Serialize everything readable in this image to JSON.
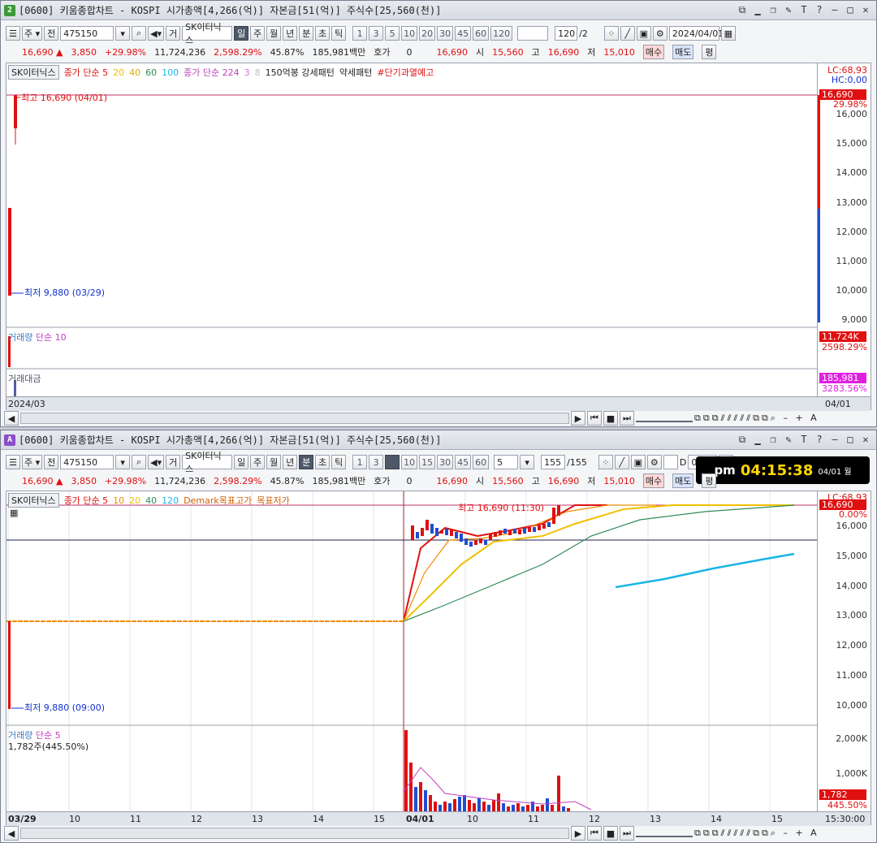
{
  "top": {
    "badge": "2",
    "title": "[0600] 키움종합차트 - KOSPI 시가총액[4,266(억)] 자본금[51(억)] 주식수[25,560(천)]",
    "toolbar": {
      "code": "475150",
      "name": "SK이터닉스",
      "periods": [
        "일",
        "주",
        "월",
        "년",
        "분",
        "초",
        "틱"
      ],
      "period_selected": "일",
      "nums": [
        "1",
        "3",
        "5",
        "10",
        "20",
        "30",
        "45",
        "60",
        "120"
      ],
      "count": "120",
      "count_suffix": "/2",
      "date": "2024/04/01"
    },
    "quote": {
      "price": "16,690",
      "change": "3,850",
      "rate": "+29.98%",
      "volume": "11,724,236",
      "vol_rate": "2,598.29%",
      "turnover": "45.87%",
      "amount": "185,981백만",
      "hoga_label": "호가",
      "hoga": "0",
      "last": "16,690",
      "open_l": "시",
      "open": "15,560",
      "high_l": "고",
      "high": "16,690",
      "low_l": "저",
      "low": "15,010",
      "buy": "매수",
      "sell": "매도",
      "avg": "평"
    },
    "legend": {
      "name": "SK이터닉스",
      "ma_label": "종가 단순 5",
      "ma2": "20",
      "ma3": "40",
      "ma4": "60",
      "ma5": "100",
      "ma_label2": "종가 단순 224",
      "m3": "3",
      "m8": "8",
      "pattern1": "150억봉 강세패턴",
      "pattern2": "약세패턴",
      "warn": "#단기과열예고"
    },
    "lc": "LC:68,93",
    "hc": "HC:0,00",
    "hi_label": "최고 16,690 (04/01)",
    "lo_label": "최저 9,880 (03/29)",
    "price_tag": "16,690",
    "pct_tag": "29.98%",
    "y_ticks": [
      "16,000",
      "15,000",
      "14,000",
      "13,000",
      "12,000",
      "11,000",
      "10,000",
      "9,000"
    ],
    "vol_legend": "거래량",
    "vol_ma": "단순 10",
    "vol_tag": "11,724K",
    "vol_pct": "2598.29%",
    "amt_legend": "거래대금",
    "amt_tag": "185,981",
    "amt_pct": "3283.56%",
    "x_left": "2024/03",
    "x_right": "04/01"
  },
  "bottom": {
    "badge": "A",
    "title": "[0600] 키움종합차트 - KOSPI 시가총액[4,266(억)] 자본금[51(억)] 주식수[25,560(천)]",
    "toolbar": {
      "code": "475150",
      "name": "SK이터닉스",
      "periods": [
        "일",
        "주",
        "월",
        "년",
        "분",
        "초",
        "틱"
      ],
      "period_selected": "분",
      "nums": [
        "1",
        "3",
        "5",
        "10",
        "15",
        "30",
        "45",
        "60"
      ],
      "num_selected": "5",
      "interval": "5",
      "count": "155",
      "count_suffix": "/155",
      "check_label": "D",
      "date": "04/01"
    },
    "clock": {
      "ampm": "pm",
      "time": "04:15:38",
      "date": "04/01 월"
    },
    "quote": {
      "price": "16,690",
      "change": "3,850",
      "rate": "+29.98%",
      "volume": "11,724,236",
      "vol_rate": "2,598.29%",
      "turnover": "45.87%",
      "amount": "185,981백만",
      "hoga_label": "호가",
      "hoga": "0",
      "last": "16,690",
      "open_l": "시",
      "open": "15,560",
      "high_l": "고",
      "high": "16,690",
      "low_l": "저",
      "low": "15,010",
      "buy": "매수",
      "sell": "매도",
      "avg": "평"
    },
    "legend": {
      "name": "SK이터닉스",
      "ma_label": "종가 단순 5",
      "ma2": "10",
      "ma3": "20",
      "ma4": "40",
      "ma5": "120",
      "demark": "Demark목표고가",
      "demark2": "목표저가"
    },
    "lc": "LC:68,93",
    "hi_label": "최고 16,690 (11:30)",
    "lo_label": "최저 9,880 (09:00)",
    "price_tag": "16,690",
    "pct_tag": "0.00%",
    "y_ticks": [
      "16,000",
      "15,000",
      "14,000",
      "13,000",
      "12,000",
      "11,000",
      "10,000"
    ],
    "vol_legend": "거래량",
    "vol_ma": "단순 5",
    "vol_info": "1,782주(445.50%)",
    "vol_ticks": [
      "2,000K",
      "1,000K"
    ],
    "vol_tag": "1,782",
    "vol_pct": "445.50%",
    "x_labels": [
      "03/29",
      "10",
      "11",
      "12",
      "13",
      "14",
      "15",
      "04/01",
      "10",
      "11",
      "12",
      "13",
      "14",
      "15"
    ],
    "x_right": "15:30:00"
  },
  "colors": {
    "up": "#e01010",
    "down": "#1f4fd0",
    "ma5": "#e01010",
    "ma10": "#f08c00",
    "ma20": "#f0c000",
    "ma40": "#2e8b57",
    "demark": "#19b5e6"
  }
}
